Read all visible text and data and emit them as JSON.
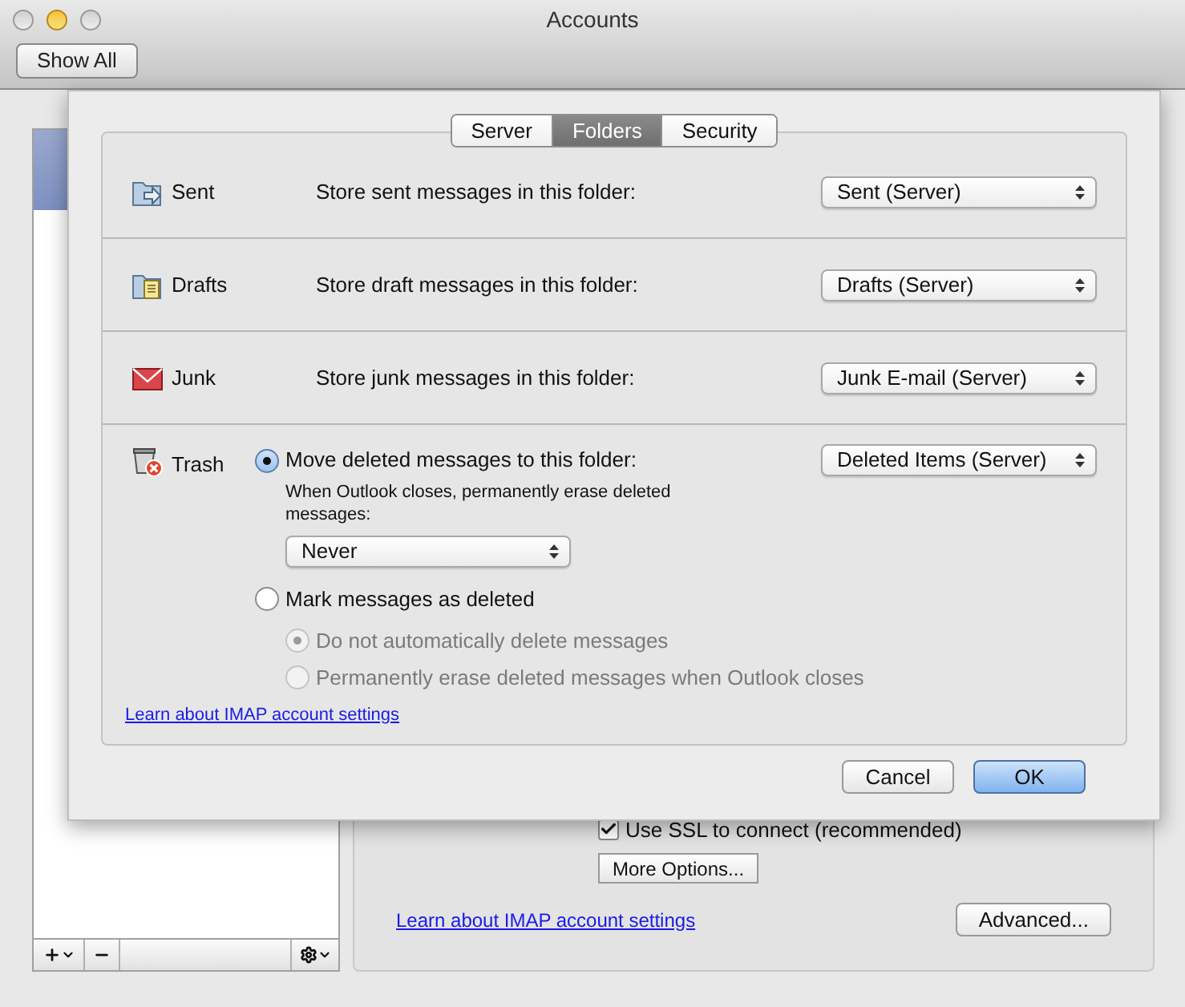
{
  "window": {
    "title": "Accounts"
  },
  "toolbar": {
    "button": "Show All"
  },
  "sheet": {
    "tabs": [
      {
        "label": "Server",
        "selected": false
      },
      {
        "label": "Folders",
        "selected": true
      },
      {
        "label": "Security",
        "selected": false
      }
    ],
    "folders": [
      {
        "kind": "sent",
        "label": "Sent",
        "description": "Store sent messages in this folder:",
        "popup": "Sent (Server)"
      },
      {
        "kind": "drafts",
        "label": "Drafts",
        "description": "Store draft messages in this folder:",
        "popup": "Drafts (Server)"
      },
      {
        "kind": "junk",
        "label": "Junk",
        "description": "Store junk messages in this folder:",
        "popup": "Junk E-mail (Server)"
      }
    ],
    "trash": {
      "label": "Trash",
      "options": [
        {
          "label": "Move deleted messages to this folder:",
          "selected": true,
          "popup": "Deleted Items (Server)",
          "note": "When Outlook closes, permanently erase deleted messages:",
          "note_popup": "Never"
        },
        {
          "label": "Mark messages as deleted",
          "selected": false,
          "suboptions": [
            {
              "label": "Do not automatically delete messages",
              "selected": true,
              "disabled": true
            },
            {
              "label": "Permanently erase deleted messages when Outlook closes",
              "selected": false,
              "disabled": true
            }
          ]
        }
      ]
    },
    "link": "Learn about IMAP account settings",
    "buttons": [
      {
        "label": "Cancel",
        "kind": "normal"
      },
      {
        "label": "OK",
        "kind": "default"
      }
    ]
  },
  "account_panel": {
    "ssl_checkbox": {
      "label": "Use SSL to connect (recommended)",
      "checked": true
    },
    "more_button": "More Options...",
    "link": "Learn about IMAP account settings",
    "advanced_button": "Advanced..."
  }
}
